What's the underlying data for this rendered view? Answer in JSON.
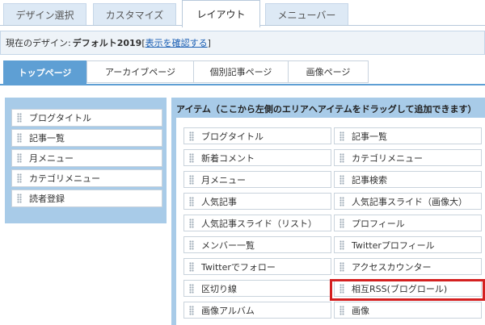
{
  "top_tabs": [
    {
      "label": "デザイン選択",
      "active": false
    },
    {
      "label": "カスタマイズ",
      "active": false
    },
    {
      "label": "レイアウト",
      "active": true
    },
    {
      "label": "メニューバー",
      "active": false
    }
  ],
  "design_bar": {
    "prefix": "現在のデザイン:",
    "design_name": "デフォルト2019",
    "link_open": "[",
    "link_label": "表示を確認する",
    "link_close": "]"
  },
  "sub_tabs": [
    {
      "label": "トップページ",
      "active": true
    },
    {
      "label": "アーカイブページ",
      "active": false
    },
    {
      "label": "個別記事ページ",
      "active": false
    },
    {
      "label": "画像ページ",
      "active": false
    }
  ],
  "left_panel": {
    "items": [
      "ブログタイトル",
      "記事一覧",
      "月メニュー",
      "カテゴリメニュー",
      "読者登録"
    ]
  },
  "right_panel": {
    "title": "アイテム（ここから左側のエリアへアイテムをドラッグして追加できます）",
    "items": [
      "ブログタイトル",
      "記事一覧",
      "新着コメント",
      "カテゴリメニュー",
      "月メニュー",
      "記事検索",
      "人気記事",
      "人気記事スライド（画像大）",
      "人気記事スライド（リスト）",
      "プロフィール",
      "メンバー一覧",
      "Twitterプロフィール",
      "Twitterでフォロー",
      "アクセスカウンター",
      "区切り線",
      "相互RSS(ブログロール)",
      "画像アルバム",
      "画像"
    ],
    "highlighted_item": "相互RSS(ブログロール)"
  },
  "colors": {
    "accent_blue": "#5e9fd4",
    "panel_blue": "#a8cbe8",
    "highlight_red": "#d42020"
  }
}
